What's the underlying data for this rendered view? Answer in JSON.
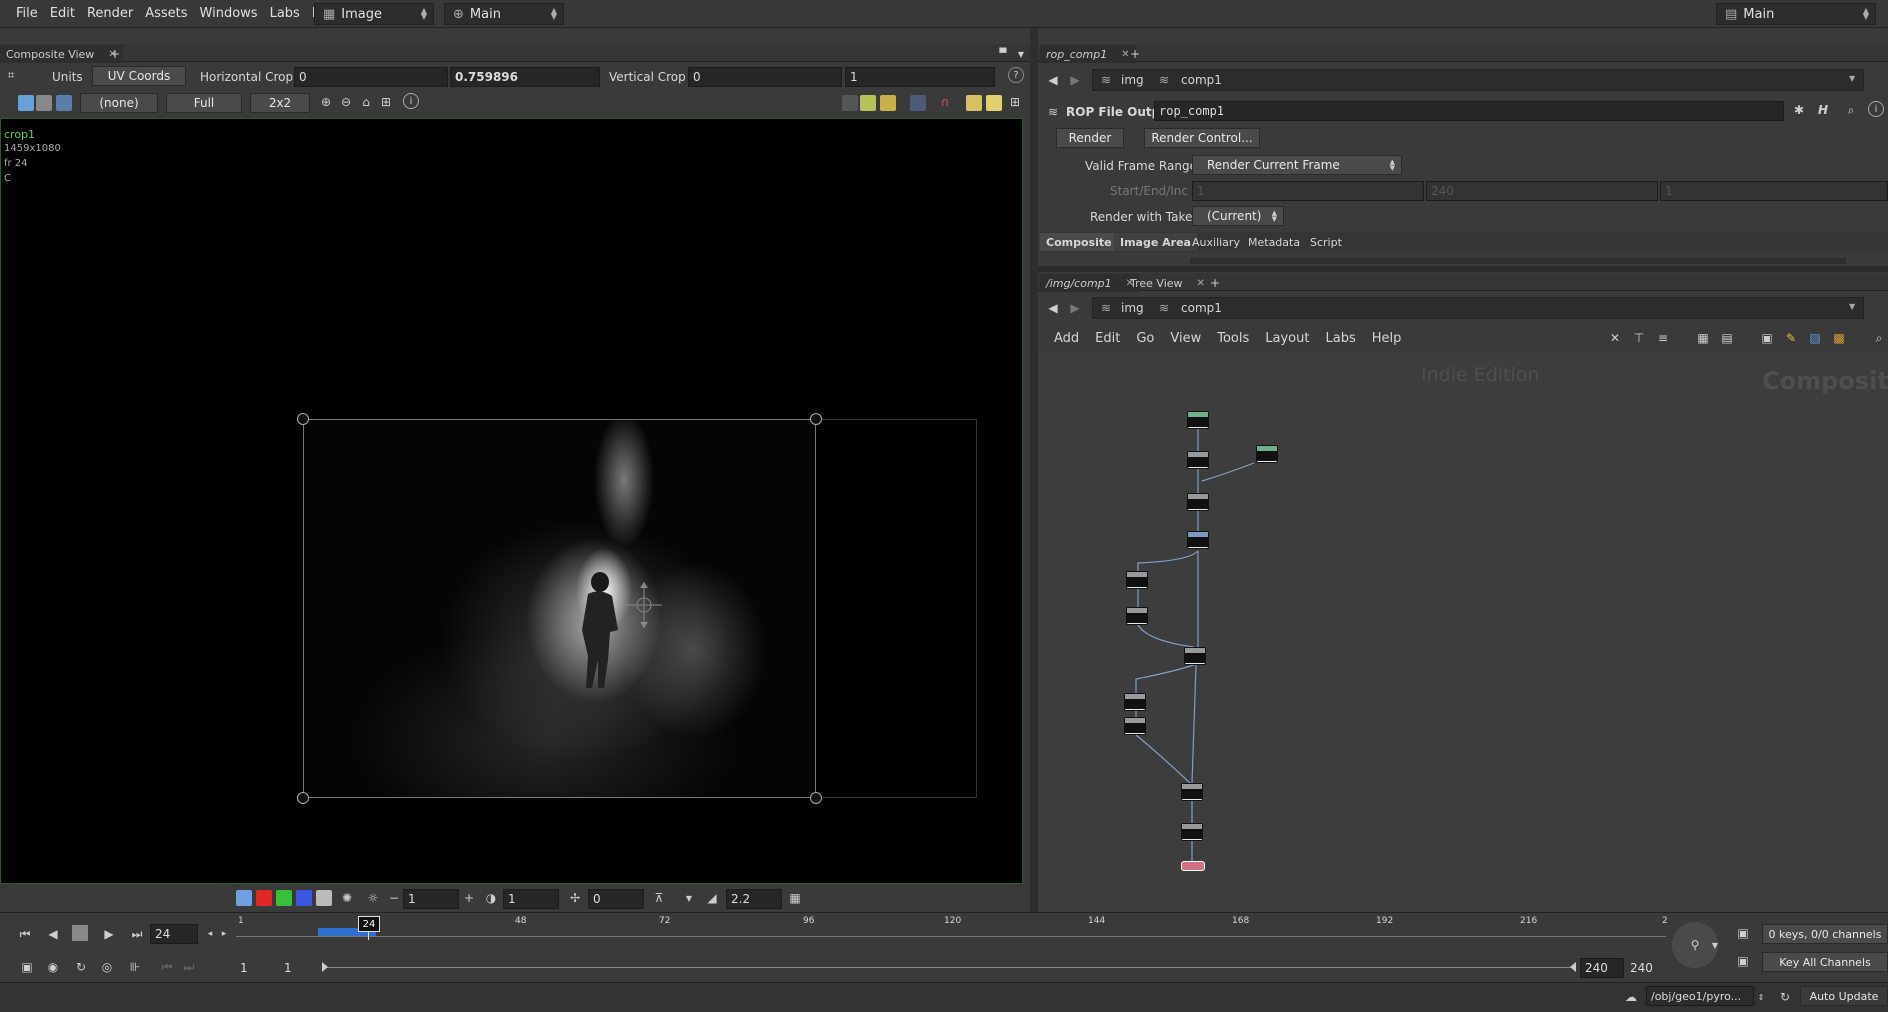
{
  "menubar": {
    "items": [
      "File",
      "Edit",
      "Render",
      "Assets",
      "Windows",
      "Labs",
      "Help"
    ],
    "desktop_dropdown": "Image",
    "network_dropdown": "Main",
    "right_dropdown": "Main"
  },
  "left_pane": {
    "tab_label": "Composite View",
    "toolbar1": {
      "units_label": "Units",
      "units_value": "UV Coords",
      "hcrop_label": "Horizontal Crop",
      "hcrop_min": "0",
      "hcrop_max": "0.759896",
      "vcrop_label": "Vertical Crop",
      "vcrop_min": "0",
      "vcrop_max": "1"
    },
    "toolbar2": {
      "plane": "(none)",
      "res": "Full",
      "sampling": "2x2"
    },
    "viewer_info": {
      "node": "crop1",
      "resolution": "1459x1080",
      "frame": "fr 24",
      "channel": "C"
    },
    "bottom_bar": {
      "field1": "1",
      "field2": "1",
      "field3": "0",
      "gamma": "2.2"
    }
  },
  "timeline": {
    "current_frame": "24",
    "marker": "24",
    "ticks": [
      "1",
      "48",
      "72",
      "96",
      "120",
      "144",
      "168",
      "192",
      "216",
      "2"
    ],
    "range_start": "1",
    "range_start2": "1",
    "range_end": "240",
    "range_end2": "240",
    "keys_label": "0 keys, 0/0 channels",
    "key_all_label": "Key All Channels"
  },
  "statusbar": {
    "path": "/obj/geo1/pyro...",
    "auto_update": "Auto Update"
  },
  "param_pane": {
    "tab_label": "rop_comp1",
    "path": [
      "img",
      "comp1"
    ],
    "node_type": "ROP File Output",
    "node_name": "rop_comp1",
    "render_button": "Render",
    "render_control_button": "Render Control...",
    "frame_range_label": "Valid Frame Range",
    "frame_range_value": "Render Current Frame",
    "start_end_label": "Start/End/Inc",
    "start": "1",
    "end": "240",
    "inc": "1",
    "take_label": "Render with Take",
    "take_value": "(Current)",
    "subtabs": [
      "Composite",
      "Image Area",
      "Auxiliary",
      "Metadata",
      "Script"
    ]
  },
  "network_pane": {
    "tab1_label": "/img/comp1",
    "tab2_label": "Tree View",
    "path": [
      "img",
      "comp1"
    ],
    "menu": [
      "Add",
      "Edit",
      "Go",
      "View",
      "Tools",
      "Layout",
      "Labs",
      "Help"
    ],
    "watermark_edition": "Indie Edition",
    "watermark_context": "Compositin"
  }
}
